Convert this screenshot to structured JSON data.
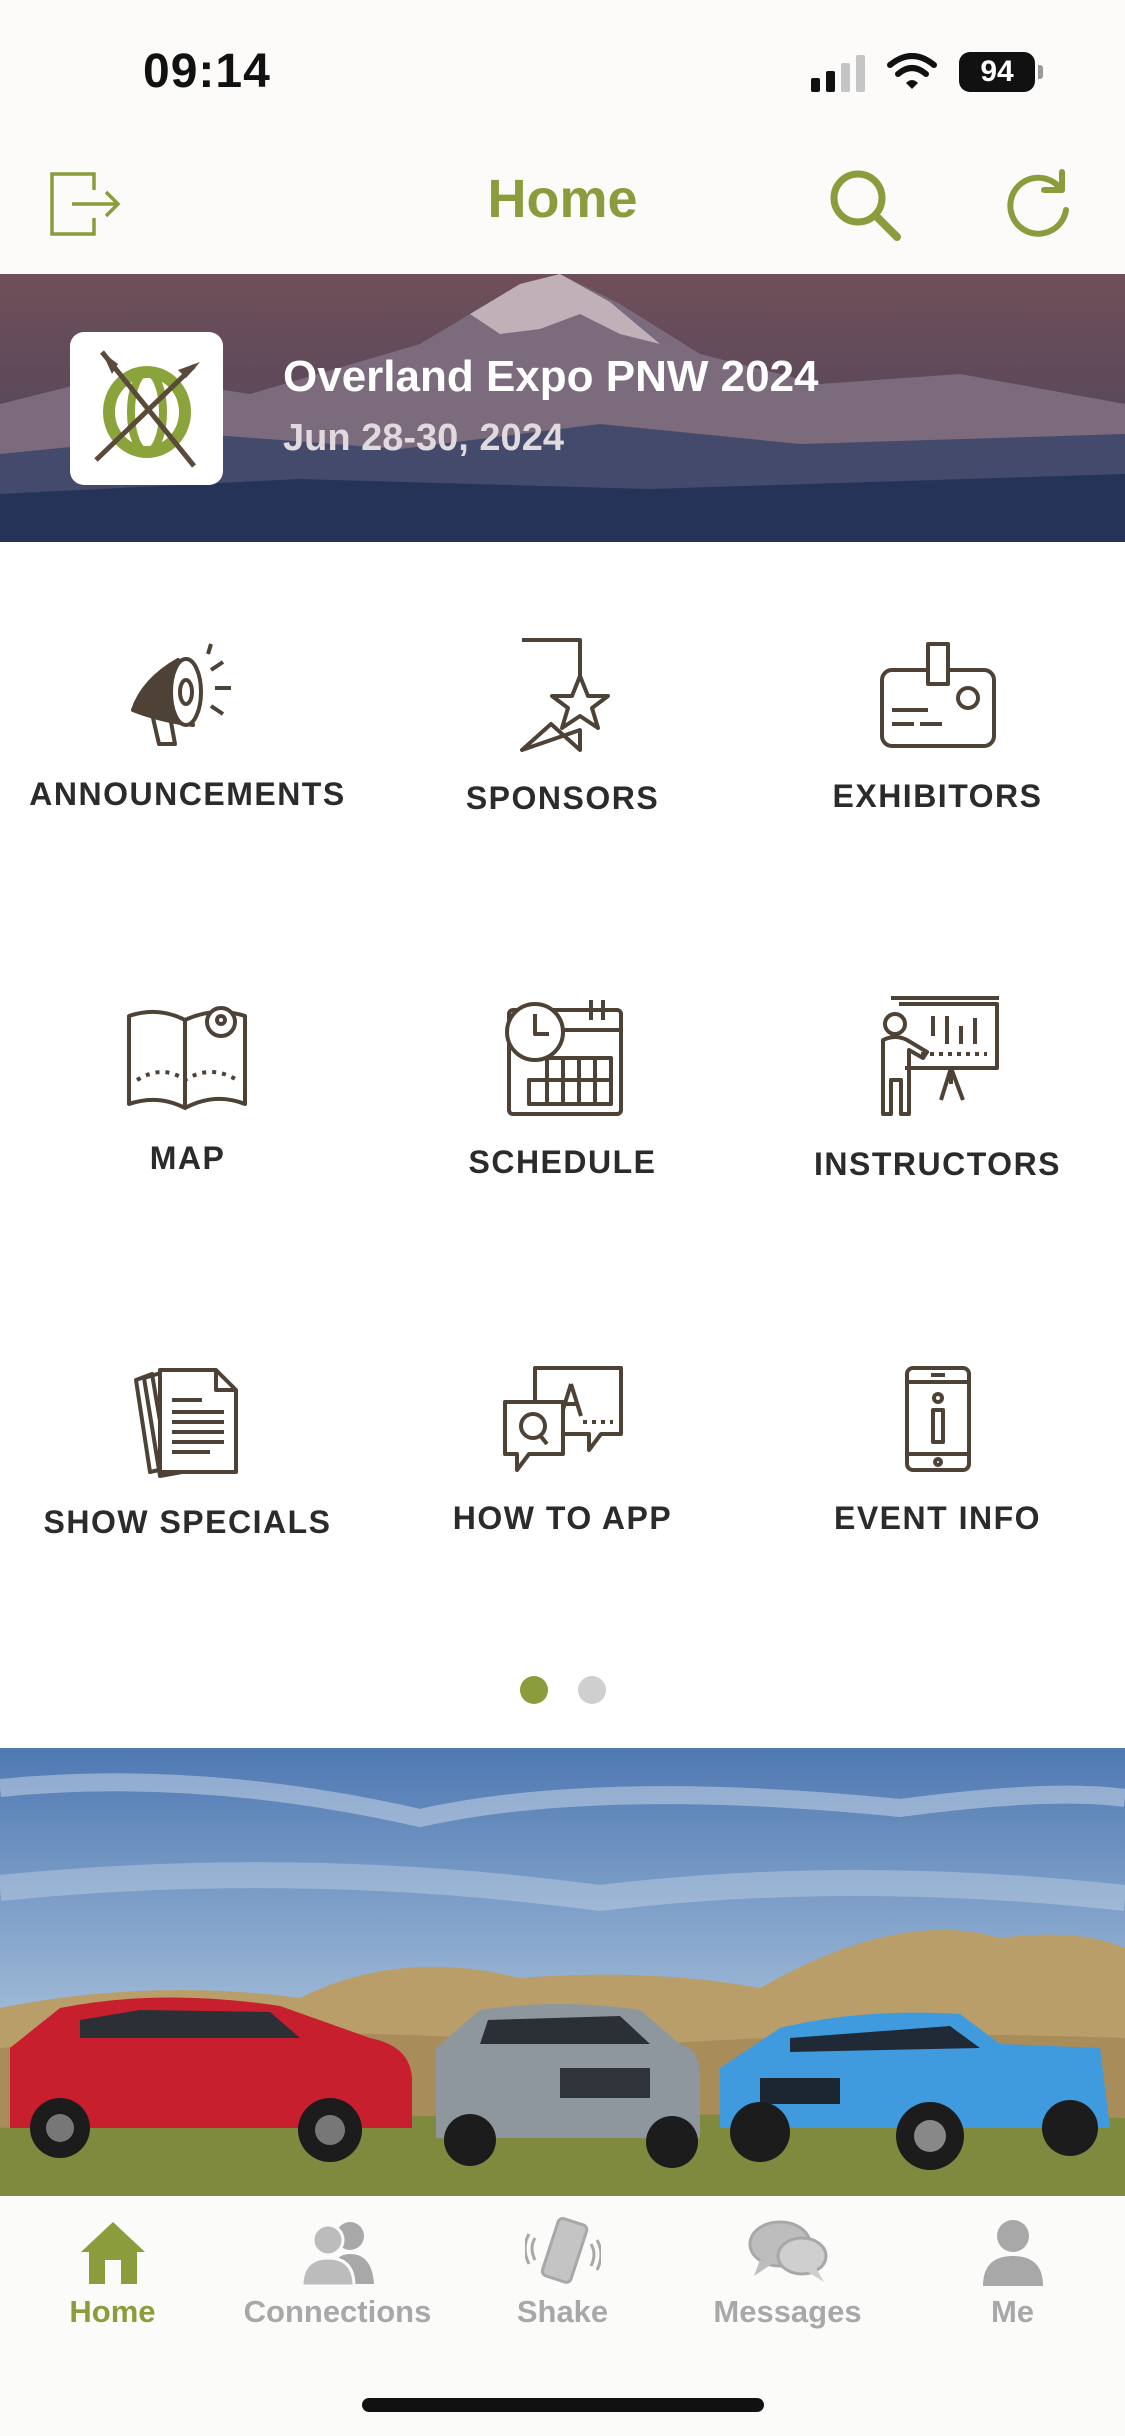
{
  "status_bar": {
    "time": "09:14",
    "battery": "94"
  },
  "header": {
    "title": "Home"
  },
  "event": {
    "name": "Overland Expo PNW 2024",
    "dates": "Jun 28-30, 2024"
  },
  "grid": {
    "items": [
      {
        "label": "ANNOUNCEMENTS",
        "icon": "megaphone-icon"
      },
      {
        "label": "SPONSORS",
        "icon": "bookmark-star-icon"
      },
      {
        "label": "EXHIBITORS",
        "icon": "badge-icon"
      },
      {
        "label": "MAP",
        "icon": "map-icon"
      },
      {
        "label": "SCHEDULE",
        "icon": "calendar-clock-icon"
      },
      {
        "label": "INSTRUCTORS",
        "icon": "presenter-icon"
      },
      {
        "label": "SHOW SPECIALS",
        "icon": "documents-icon"
      },
      {
        "label": "HOW TO APP",
        "icon": "qa-icon"
      },
      {
        "label": "EVENT INFO",
        "icon": "phone-info-icon"
      }
    ]
  },
  "pager": {
    "pages": 2,
    "current": 1
  },
  "tabs": [
    {
      "label": "Home",
      "icon": "home-icon",
      "active": true
    },
    {
      "label": "Connections",
      "icon": "people-icon",
      "active": false
    },
    {
      "label": "Shake",
      "icon": "shake-phone-icon",
      "active": false
    },
    {
      "label": "Messages",
      "icon": "chat-bubbles-icon",
      "active": false
    },
    {
      "label": "Me",
      "icon": "person-icon",
      "active": false
    }
  ],
  "colors": {
    "accent": "#8a9c3c",
    "icon": "#4e4236",
    "inactive": "#a8a8a8"
  }
}
